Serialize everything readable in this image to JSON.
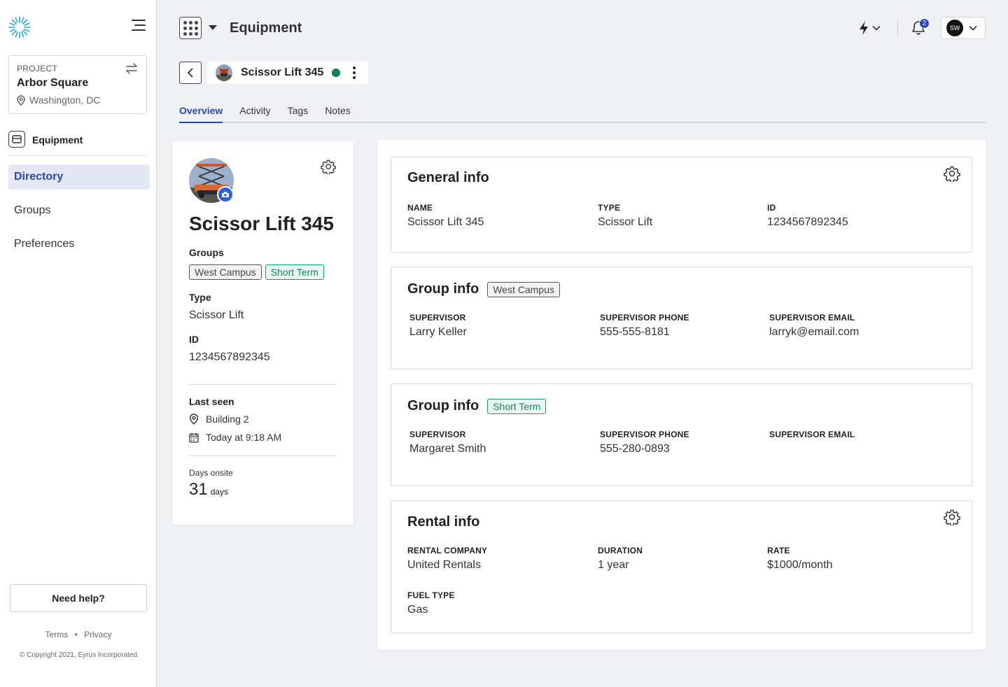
{
  "sidebar": {
    "project_label": "PROJECT",
    "project_name": "Arbor Square",
    "project_location": "Washington, DC",
    "module_label": "Equipment",
    "nav": [
      "Directory",
      "Groups",
      "Preferences"
    ],
    "help_label": "Need help?",
    "terms": "Terms",
    "privacy": "Privacy",
    "copyright": "© Copyright 2021, Eyrus Incorporated"
  },
  "topbar": {
    "title": "Equipment",
    "notification_count": "2",
    "user_initials": "SW"
  },
  "asset": {
    "name": "Scissor Lift 345",
    "status_color": "#0b7d66"
  },
  "tabs": [
    "Overview",
    "Activity",
    "Tags",
    "Notes"
  ],
  "summary": {
    "name": "Scissor Lift 345",
    "groups_label": "Groups",
    "groups": [
      "West Campus",
      "Short Term"
    ],
    "type_label": "Type",
    "type": "Scissor Lift",
    "id_label": "ID",
    "id": "1234567892345",
    "last_seen_label": "Last seen",
    "last_seen_location": "Building 2",
    "last_seen_time": "Today at 9:18 AM",
    "days_onsite_label": "Days onsite",
    "days_onsite_value": "31",
    "days_onsite_unit": "days"
  },
  "general_info": {
    "title": "General info",
    "fields": [
      {
        "label": "NAME",
        "value": "Scissor Lift 345"
      },
      {
        "label": "TYPE",
        "value": "Scissor Lift"
      },
      {
        "label": "ID",
        "value": "1234567892345"
      }
    ]
  },
  "group_info_1": {
    "title": "Group info",
    "tag": "West Campus",
    "fields": [
      {
        "label": "SUPERVISOR",
        "value": "Larry Keller"
      },
      {
        "label": "SUPERVISOR PHONE",
        "value": "555-555-8181"
      },
      {
        "label": "SUPERVISOR EMAIL",
        "value": "larryk@email.com"
      }
    ]
  },
  "group_info_2": {
    "title": "Group info",
    "tag": "Short Term",
    "fields": [
      {
        "label": "SUPERVISOR",
        "value": "Margaret Smith"
      },
      {
        "label": "SUPERVISOR PHONE",
        "value": "555-280-0893"
      },
      {
        "label": "SUPERVISOR EMAIL",
        "value": ""
      }
    ]
  },
  "rental_info": {
    "title": "Rental info",
    "fields": [
      {
        "label": "RENTAL COMPANY",
        "value": "United Rentals"
      },
      {
        "label": "DURATION",
        "value": "1 year"
      },
      {
        "label": "RATE",
        "value": "$1000/month"
      },
      {
        "label": "FUEL TYPE",
        "value": "Gas"
      }
    ]
  },
  "colors": {
    "accent": "#2a46b8",
    "active_status": "#0b7d66",
    "tag_green": "#0d8a5e"
  }
}
